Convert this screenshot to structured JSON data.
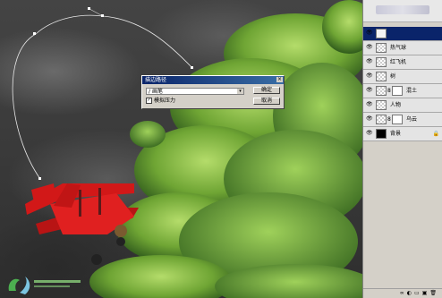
{
  "dialog": {
    "title": "描边路径",
    "close_glyph": "×",
    "tool_icon": "brush-icon",
    "tool_value": "画笔",
    "dropdown_arrow": "▾",
    "simulate_pressure_label": "模拟压力",
    "simulate_pressure_checked": true,
    "check_glyph": "✓",
    "ok_label": "确定",
    "cancel_label": "取消"
  },
  "layers_panel": {
    "layers": [
      {
        "name": "",
        "visible": true,
        "selected": true,
        "kind": "blank"
      },
      {
        "name": "热气球",
        "visible": true,
        "selected": false,
        "kind": "transparent"
      },
      {
        "name": "红飞机",
        "visible": true,
        "selected": false,
        "kind": "transparent"
      },
      {
        "name": "树",
        "visible": true,
        "selected": false,
        "kind": "transparent"
      },
      {
        "name": "混土",
        "visible": true,
        "selected": false,
        "kind": "with-mask"
      },
      {
        "name": "人物",
        "visible": true,
        "selected": false,
        "kind": "transparent"
      },
      {
        "name": "乌云",
        "visible": true,
        "selected": false,
        "kind": "with-mask"
      },
      {
        "name": "背景",
        "visible": true,
        "selected": false,
        "kind": "black",
        "locked": true
      }
    ],
    "eye_glyph": "👁",
    "lock_glyph": "🔒",
    "link_glyph": "8",
    "bottom_icons": [
      "∞",
      "◐",
      "▭",
      "▣",
      "🗑"
    ]
  },
  "colors": {
    "sky": "#3a3a3a",
    "tree": "#7cb342",
    "plane": "#e02020",
    "selection": "#0a246a",
    "dialog_bg": "#d4d0c8"
  }
}
